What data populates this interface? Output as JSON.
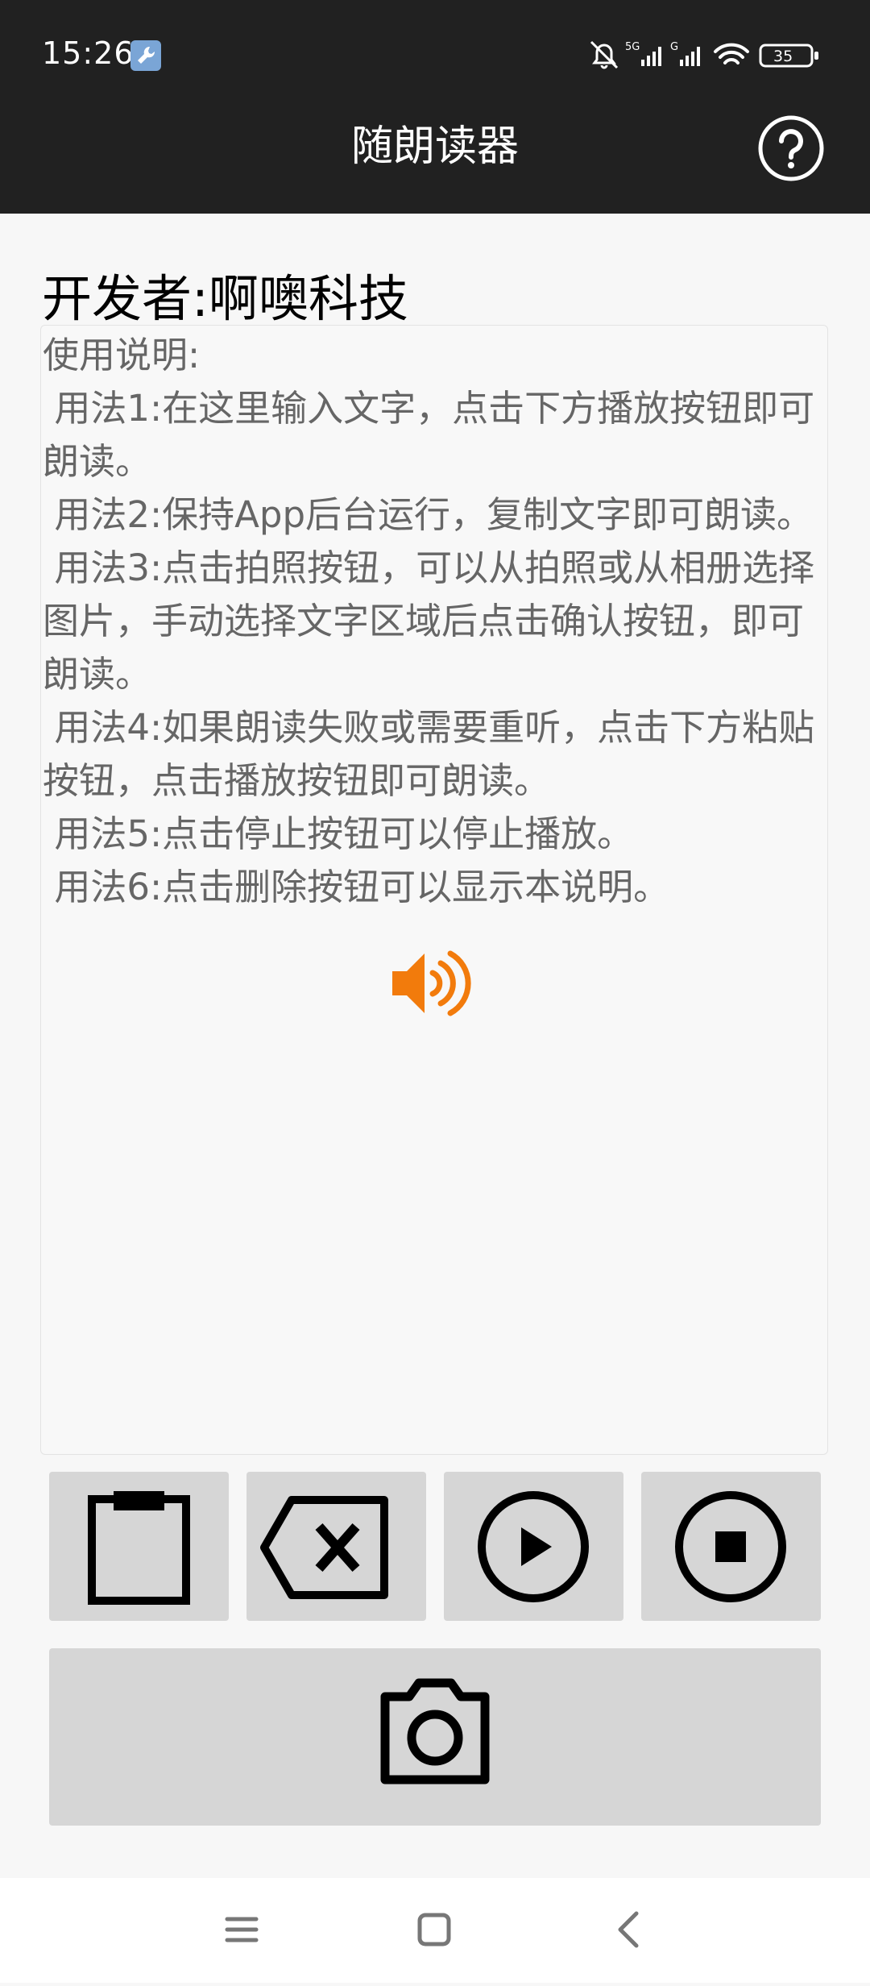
{
  "status_bar": {
    "time": "15:26",
    "battery": "35",
    "network1": "5G",
    "network2": "G"
  },
  "app_bar": {
    "title": "随朗读器"
  },
  "developer_text": "开发者:啊噢科技",
  "instructions": "使用说明:\n 用法1:在这里输入文字，点击下方播放按钮即可朗读。\n 用法2:保持App后台运行，复制文字即可朗读。\n 用法3:点击拍照按钮，可以从拍照或从相册选择图片，手动选择文字区域后点击确认按钮，即可朗读。\n 用法4:如果朗读失败或需要重听，点击下方粘贴按钮，点击播放按钮即可朗读。\n 用法5:点击停止按钮可以停止播放。\n 用法6:点击删除按钮可以显示本说明。",
  "buttons": [
    {
      "name": "paste",
      "icon": "clipboard-icon"
    },
    {
      "name": "delete",
      "icon": "backspace-icon"
    },
    {
      "name": "play",
      "icon": "play-icon"
    },
    {
      "name": "stop",
      "icon": "stop-icon"
    },
    {
      "name": "camera",
      "icon": "camera-icon"
    }
  ],
  "colors": {
    "bar": "#212121",
    "background": "#f7f7f7",
    "button": "#d6d6d6",
    "speaker": "#f27b0c"
  }
}
